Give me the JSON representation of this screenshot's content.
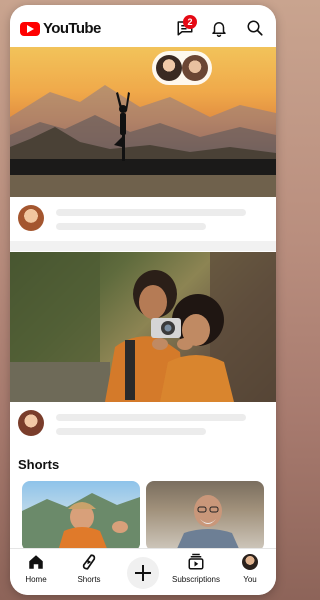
{
  "app": {
    "brand_name": "YouTube",
    "brand_color": "#FF0000"
  },
  "header": {
    "notifications_badge": "2",
    "icons": [
      "messages-icon",
      "bell-icon",
      "search-icon"
    ]
  },
  "feed": {
    "shorts_title": "Shorts"
  },
  "bottom_nav": {
    "items": [
      {
        "label": "Home",
        "icon": "home-icon"
      },
      {
        "label": "Shorts",
        "icon": "shorts-icon"
      },
      {
        "label": "",
        "icon": "plus-icon"
      },
      {
        "label": "Subscriptions",
        "icon": "subscriptions-icon"
      },
      {
        "label": "You",
        "icon": "avatar"
      }
    ]
  }
}
